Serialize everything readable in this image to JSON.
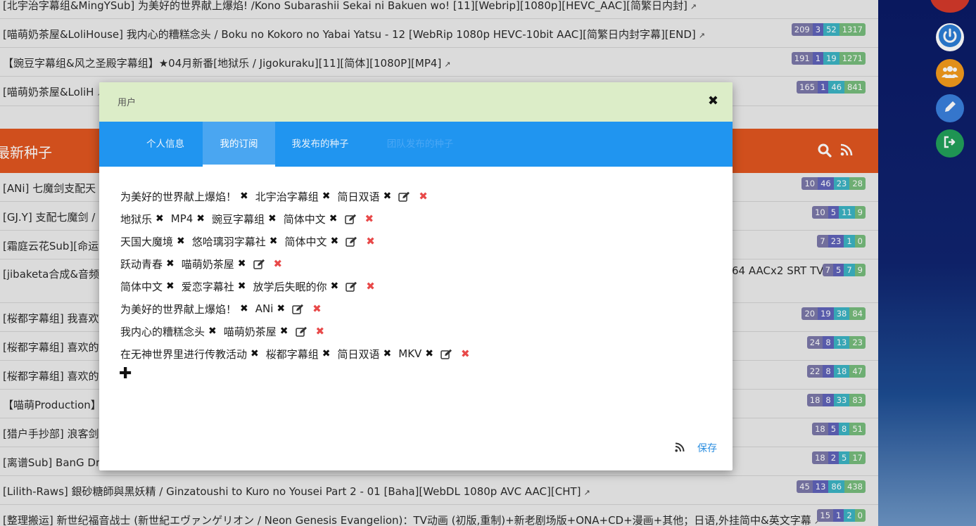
{
  "background_list": {
    "rows_top": [
      {
        "title": "[北宇治字幕组&MingYSub] 为美好的世界献上爆焰! /Kono Subarashii Sekai ni Bakuen wo! [11][Webrip][1080p][HEVC_AAC][简繁日内封]",
        "badges": []
      },
      {
        "title": "[喵萌奶茶屋&LoliHouse] 我内心的糟糕念头 / Boku no Kokoro no Yabai Yatsu - 12 [WebRip 1080p HEVC-10bit AAC][简繁日内封字幕][END]",
        "badges": [
          "209",
          "3",
          "52",
          "1317"
        ]
      },
      {
        "title": "【豌豆字幕组&风之圣殿字幕组】★04月新番[地狱乐 / Jigokuraku][11][简体][1080P][MP4]",
        "badges": [
          "191",
          "1",
          "19",
          "1271"
        ]
      },
      {
        "title": "[喵萌奶茶屋&LoliH",
        "badges": [
          "165",
          "1",
          "46",
          "841"
        ]
      }
    ],
    "section_title": "最新种子",
    "rows_bottom": [
      {
        "title": "[ANi] 七魔剑支配天",
        "badges": [
          "10",
          "46",
          "23",
          "28"
        ]
      },
      {
        "title": "[GJ.Y] 支配七魔剑 /",
        "badges": [
          "10",
          "5",
          "11",
          "9"
        ]
      },
      {
        "title": "[霜庭云花Sub][命运",
        "badges": [
          "7",
          "23",
          "1",
          "0"
        ]
      },
      {
        "title": "[jibaketa合成&音频",
        "tail": "64 AACx2 SRT TVB CHT]",
        "badges": [
          "7",
          "5",
          "7",
          "9"
        ]
      },
      {
        "title": "[桜都字幕组] 我喜欢",
        "badges": [
          "20",
          "19",
          "38",
          "84"
        ]
      },
      {
        "title": "[桜都字幕组] 喜欢的",
        "badges": [
          "24",
          "8",
          "13",
          "23"
        ]
      },
      {
        "title": "[桜都字幕组] 喜欢的",
        "badges": [
          "22",
          "8",
          "18",
          "47"
        ]
      },
      {
        "title": "【喵萌Production】",
        "badges": [
          "18",
          "8",
          "33",
          "83"
        ]
      },
      {
        "title": "[猎户手抄部] 浪客剑",
        "badges": [
          "18",
          "5",
          "8",
          "51"
        ]
      },
      {
        "title": "[离谱Sub] BanG Dr",
        "badges": [
          "18",
          "2",
          "5",
          "17"
        ]
      },
      {
        "title": "[Lilith-Raws] 銀砂糖師與黑妖精 / Ginzatoushi to Kuro no Yousei Part 2 - 01 [Baha][WebDL 1080p AVC AAC][CHT]",
        "badges": [
          "45",
          "13",
          "86",
          "438"
        ]
      },
      {
        "title": "[整理搬运] 新世纪福音战士 (新世紀エヴァンゲリオン / Neon Genesis Evangelion)：TV动画 (初版,重制)+新老剧场版+ONA+CD+漫画+其他；日语,外挂简中&英文字幕",
        "badges": [
          "15",
          "1",
          "2",
          "0"
        ]
      }
    ]
  },
  "modal": {
    "title": "用户",
    "tabs": [
      {
        "label": "个人信息",
        "active": false
      },
      {
        "label": "我的订阅",
        "active": true
      },
      {
        "label": "我发布的种子",
        "active": false
      },
      {
        "label": "团队发布的种子",
        "active": false
      }
    ],
    "subscriptions": [
      [
        "为美好的世界献上爆焰！",
        "北宇治字幕组",
        "简日双语"
      ],
      [
        "地狱乐",
        "MP4",
        "豌豆字幕组",
        "简体中文"
      ],
      [
        "天国大魔境",
        "悠哈璃羽字幕社",
        "简体中文"
      ],
      [
        "跃动青春",
        "喵萌奶茶屋"
      ],
      [
        "简体中文",
        "爱恋字幕社",
        "放学后失眠的你"
      ],
      [
        "为美好的世界献上爆焰！",
        "ANi"
      ],
      [
        "我内心的糟糕念头",
        "喵萌奶茶屋"
      ],
      [
        "在无神世界里进行传教活动",
        "桜都字幕组",
        "简日双语",
        "MKV"
      ]
    ],
    "save_label": "保存"
  },
  "colors": {
    "section_header": "#e05620",
    "modal_header": "#dcedc8",
    "tabs_bar": "#2095f0",
    "delete": "#e84949",
    "save_link": "#2b8ee0",
    "sidebar_power": "#2c7dd6",
    "sidebar_team": "#f39a1d",
    "sidebar_edit": "#3a7fdc",
    "sidebar_exit": "#22a05a",
    "sidebar_top": "#d43a2a"
  },
  "icons": {
    "close": "close-icon",
    "remove_keyword": "remove-keyword-icon",
    "edit": "edit-icon",
    "delete": "delete-icon",
    "add": "plus-icon",
    "rss": "rss-icon",
    "search": "search-icon",
    "power": "power-icon",
    "team": "team-icon",
    "pencil": "pencil-icon",
    "logout": "logout-icon"
  }
}
